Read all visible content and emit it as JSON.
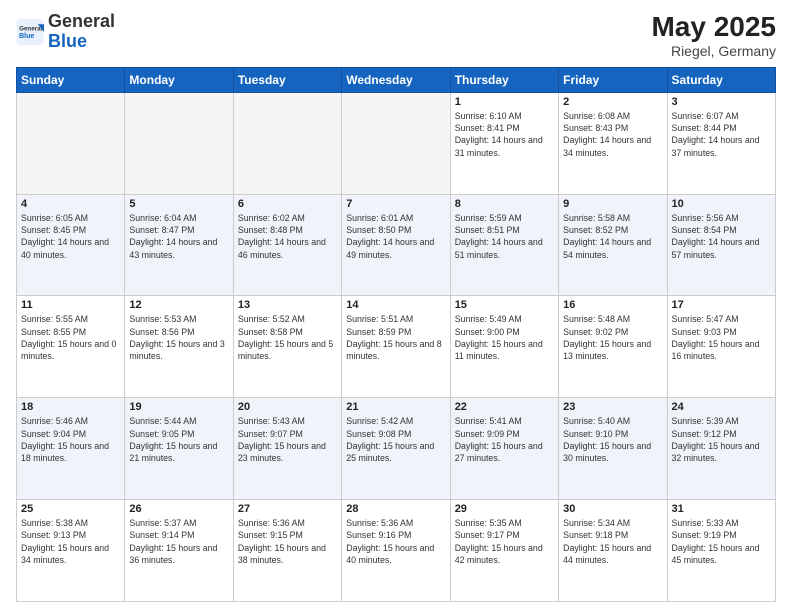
{
  "header": {
    "logo_general": "General",
    "logo_blue": "Blue",
    "month_year": "May 2025",
    "location": "Riegel, Germany"
  },
  "weekdays": [
    "Sunday",
    "Monday",
    "Tuesday",
    "Wednesday",
    "Thursday",
    "Friday",
    "Saturday"
  ],
  "weeks": [
    [
      {
        "day": "",
        "empty": true
      },
      {
        "day": "",
        "empty": true
      },
      {
        "day": "",
        "empty": true
      },
      {
        "day": "",
        "empty": true
      },
      {
        "day": "1",
        "sunrise": "6:10 AM",
        "sunset": "8:41 PM",
        "daylight": "14 hours and 31 minutes."
      },
      {
        "day": "2",
        "sunrise": "6:08 AM",
        "sunset": "8:43 PM",
        "daylight": "14 hours and 34 minutes."
      },
      {
        "day": "3",
        "sunrise": "6:07 AM",
        "sunset": "8:44 PM",
        "daylight": "14 hours and 37 minutes."
      }
    ],
    [
      {
        "day": "4",
        "sunrise": "6:05 AM",
        "sunset": "8:45 PM",
        "daylight": "14 hours and 40 minutes."
      },
      {
        "day": "5",
        "sunrise": "6:04 AM",
        "sunset": "8:47 PM",
        "daylight": "14 hours and 43 minutes."
      },
      {
        "day": "6",
        "sunrise": "6:02 AM",
        "sunset": "8:48 PM",
        "daylight": "14 hours and 46 minutes."
      },
      {
        "day": "7",
        "sunrise": "6:01 AM",
        "sunset": "8:50 PM",
        "daylight": "14 hours and 49 minutes."
      },
      {
        "day": "8",
        "sunrise": "5:59 AM",
        "sunset": "8:51 PM",
        "daylight": "14 hours and 51 minutes."
      },
      {
        "day": "9",
        "sunrise": "5:58 AM",
        "sunset": "8:52 PM",
        "daylight": "14 hours and 54 minutes."
      },
      {
        "day": "10",
        "sunrise": "5:56 AM",
        "sunset": "8:54 PM",
        "daylight": "14 hours and 57 minutes."
      }
    ],
    [
      {
        "day": "11",
        "sunrise": "5:55 AM",
        "sunset": "8:55 PM",
        "daylight": "15 hours and 0 minutes."
      },
      {
        "day": "12",
        "sunrise": "5:53 AM",
        "sunset": "8:56 PM",
        "daylight": "15 hours and 3 minutes."
      },
      {
        "day": "13",
        "sunrise": "5:52 AM",
        "sunset": "8:58 PM",
        "daylight": "15 hours and 5 minutes."
      },
      {
        "day": "14",
        "sunrise": "5:51 AM",
        "sunset": "8:59 PM",
        "daylight": "15 hours and 8 minutes."
      },
      {
        "day": "15",
        "sunrise": "5:49 AM",
        "sunset": "9:00 PM",
        "daylight": "15 hours and 11 minutes."
      },
      {
        "day": "16",
        "sunrise": "5:48 AM",
        "sunset": "9:02 PM",
        "daylight": "15 hours and 13 minutes."
      },
      {
        "day": "17",
        "sunrise": "5:47 AM",
        "sunset": "9:03 PM",
        "daylight": "15 hours and 16 minutes."
      }
    ],
    [
      {
        "day": "18",
        "sunrise": "5:46 AM",
        "sunset": "9:04 PM",
        "daylight": "15 hours and 18 minutes."
      },
      {
        "day": "19",
        "sunrise": "5:44 AM",
        "sunset": "9:05 PM",
        "daylight": "15 hours and 21 minutes."
      },
      {
        "day": "20",
        "sunrise": "5:43 AM",
        "sunset": "9:07 PM",
        "daylight": "15 hours and 23 minutes."
      },
      {
        "day": "21",
        "sunrise": "5:42 AM",
        "sunset": "9:08 PM",
        "daylight": "15 hours and 25 minutes."
      },
      {
        "day": "22",
        "sunrise": "5:41 AM",
        "sunset": "9:09 PM",
        "daylight": "15 hours and 27 minutes."
      },
      {
        "day": "23",
        "sunrise": "5:40 AM",
        "sunset": "9:10 PM",
        "daylight": "15 hours and 30 minutes."
      },
      {
        "day": "24",
        "sunrise": "5:39 AM",
        "sunset": "9:12 PM",
        "daylight": "15 hours and 32 minutes."
      }
    ],
    [
      {
        "day": "25",
        "sunrise": "5:38 AM",
        "sunset": "9:13 PM",
        "daylight": "15 hours and 34 minutes."
      },
      {
        "day": "26",
        "sunrise": "5:37 AM",
        "sunset": "9:14 PM",
        "daylight": "15 hours and 36 minutes."
      },
      {
        "day": "27",
        "sunrise": "5:36 AM",
        "sunset": "9:15 PM",
        "daylight": "15 hours and 38 minutes."
      },
      {
        "day": "28",
        "sunrise": "5:36 AM",
        "sunset": "9:16 PM",
        "daylight": "15 hours and 40 minutes."
      },
      {
        "day": "29",
        "sunrise": "5:35 AM",
        "sunset": "9:17 PM",
        "daylight": "15 hours and 42 minutes."
      },
      {
        "day": "30",
        "sunrise": "5:34 AM",
        "sunset": "9:18 PM",
        "daylight": "15 hours and 44 minutes."
      },
      {
        "day": "31",
        "sunrise": "5:33 AM",
        "sunset": "9:19 PM",
        "daylight": "15 hours and 45 minutes."
      }
    ]
  ],
  "labels": {
    "sunrise": "Sunrise:",
    "sunset": "Sunset:",
    "daylight": "Daylight hours"
  }
}
